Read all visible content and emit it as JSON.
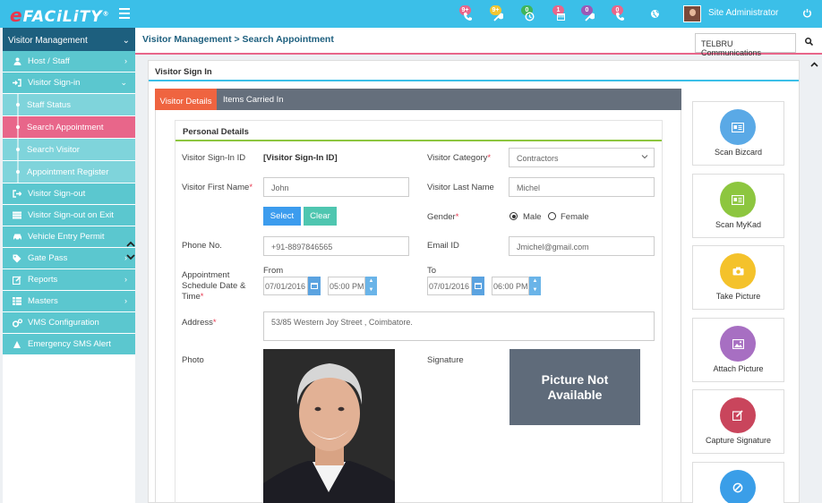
{
  "app": {
    "logo_e": "e",
    "logo_rest": "FACiLiTY",
    "logo_mark": "®"
  },
  "topbar": {
    "notifications": [
      {
        "icon": "phone-icon",
        "count": "9+",
        "color": "#e8668a"
      },
      {
        "icon": "wrench-icon",
        "count": "9+",
        "color": "#f2c531"
      },
      {
        "icon": "clock-icon",
        "count": "0",
        "color": "#3fb55a"
      },
      {
        "icon": "calendar-icon",
        "count": "1",
        "color": "#e8668a"
      },
      {
        "icon": "wrench-icon",
        "count": "0",
        "color": "#9b59b6"
      },
      {
        "icon": "phone-icon",
        "count": "0",
        "color": "#e8668a"
      }
    ],
    "user_name": "Site Administrator"
  },
  "sidebar": {
    "header": "Visitor Management",
    "items": [
      {
        "label": "Host / Staff",
        "icon": "user-icon",
        "arrow": "›",
        "type": "item"
      },
      {
        "label": "Visitor Sign-in",
        "icon": "sign-in-icon",
        "arrow": "⌄",
        "type": "item"
      },
      {
        "label": "Staff Status",
        "type": "sub"
      },
      {
        "label": "Search Appointment",
        "type": "sub",
        "active": true
      },
      {
        "label": "Search Visitor",
        "type": "sub"
      },
      {
        "label": "Appointment Register",
        "type": "sub"
      },
      {
        "label": "Visitor Sign-out",
        "icon": "sign-out-icon",
        "arrow": "",
        "type": "item"
      },
      {
        "label": "Visitor Sign-out on Exit",
        "icon": "server-icon",
        "arrow": "",
        "type": "item"
      },
      {
        "label": "Vehicle Entry Permit",
        "icon": "car-icon",
        "arrow": "",
        "type": "item"
      },
      {
        "label": "Gate Pass",
        "icon": "tag-icon",
        "arrow": "›",
        "type": "item"
      },
      {
        "label": "Reports",
        "icon": "edit-icon",
        "arrow": "›",
        "type": "item"
      },
      {
        "label": "Masters",
        "icon": "table-icon",
        "arrow": "›",
        "type": "item"
      },
      {
        "label": "VMS Configuration",
        "icon": "cogs-icon",
        "arrow": "",
        "type": "item"
      },
      {
        "label": "Emergency SMS Alert",
        "icon": "alert-icon",
        "arrow": "",
        "type": "item"
      }
    ]
  },
  "header": {
    "breadcrumb": "Visitor Management > Search Appointment",
    "org": "TELBRU Communications"
  },
  "card": {
    "title": "Visitor Sign In",
    "tabs": [
      "Visitor Details",
      "Items Carried In"
    ],
    "section_title": "Personal Details"
  },
  "form": {
    "signin_id_label": "Visitor Sign-In ID",
    "signin_id_value": "[Visitor Sign-In ID]",
    "category_label": "Visitor Category",
    "category_value": "Contractors",
    "first_name_label": "Visitor First Name",
    "first_name_value": "John",
    "last_name_label": "Visitor Last Name",
    "last_name_value": "Michel",
    "select_btn": "Select",
    "clear_btn": "Clear",
    "gender_label": "Gender",
    "gender_male": "Male",
    "gender_female": "Female",
    "gender_selected": "Male",
    "phone_label": "Phone No.",
    "phone_value": "+91-8897846565",
    "email_label": "Email ID",
    "email_value": "Jmichel@gmail.com",
    "schedule_label_1": "Appointment",
    "schedule_label_2": "Schedule Date &",
    "schedule_label_3": "Time",
    "from_label": "From",
    "to_label": "To",
    "from_date": "07/01/2016",
    "from_time": "05:00 PM",
    "to_date": "07/01/2016",
    "to_time": "06:00 PM",
    "address_label": "Address",
    "address_value": "53/85 Western Joy Street , Coimbatore.",
    "photo_label": "Photo",
    "signature_label": "Signature",
    "no_picture_1": "Picture Not",
    "no_picture_2": "Available",
    "required_mark": "*"
  },
  "actions": [
    {
      "label": "Scan Bizcard",
      "icon": "id-card-icon",
      "color": "#5aa9e6"
    },
    {
      "label": "Scan MyKad",
      "icon": "id-card-icon",
      "color": "#8dc63f"
    },
    {
      "label": "Take Picture",
      "icon": "camera-icon",
      "color": "#f4c22b"
    },
    {
      "label": "Attach Picture",
      "icon": "image-icon",
      "color": "#a76fc2"
    },
    {
      "label": "Capture Signature",
      "icon": "pen-icon",
      "color": "#c9455c"
    },
    {
      "label": "",
      "icon": "ban-icon",
      "color": "#3a9ee8"
    }
  ]
}
